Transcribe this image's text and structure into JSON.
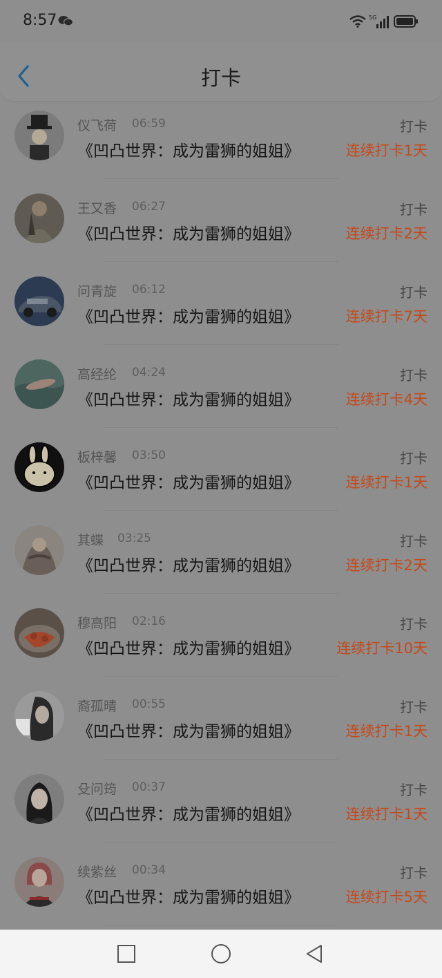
{
  "status": {
    "time": "8:57",
    "network": "5G",
    "icons": [
      "wechat-icon",
      "wifi-icon",
      "signal-icon",
      "battery-icon"
    ]
  },
  "header": {
    "title": "打卡",
    "back_icon": "chevron-left-icon"
  },
  "rows": [
    {
      "name": "仪飞荷",
      "time": "06:59",
      "book": "《凹凸世界：成为雷狮的姐姐》",
      "action": "打卡",
      "streak": "连续打卡1天"
    },
    {
      "name": "王又香",
      "time": "06:27",
      "book": "《凹凸世界：成为雷狮的姐姐》",
      "action": "打卡",
      "streak": "连续打卡2天"
    },
    {
      "name": "问青旋",
      "time": "06:12",
      "book": "《凹凸世界：成为雷狮的姐姐》",
      "action": "打卡",
      "streak": "连续打卡7天"
    },
    {
      "name": "高经纶",
      "time": "04:24",
      "book": "《凹凸世界：成为雷狮的姐姐》",
      "action": "打卡",
      "streak": "连续打卡4天"
    },
    {
      "name": "板梓馨",
      "time": "03:50",
      "book": "《凹凸世界：成为雷狮的姐姐》",
      "action": "打卡",
      "streak": "连续打卡1天"
    },
    {
      "name": "其蝶",
      "time": "03:25",
      "book": "《凹凸世界：成为雷狮的姐姐》",
      "action": "打卡",
      "streak": "连续打卡2天"
    },
    {
      "name": "穆高阳",
      "time": "02:16",
      "book": "《凹凸世界：成为雷狮的姐姐》",
      "action": "打卡",
      "streak": "连续打卡10天"
    },
    {
      "name": "裔孤晴",
      "time": "00:55",
      "book": "《凹凸世界：成为雷狮的姐姐》",
      "action": "打卡",
      "streak": "连续打卡1天"
    },
    {
      "name": "殳问筠",
      "time": "00:37",
      "book": "《凹凸世界：成为雷狮的姐姐》",
      "action": "打卡",
      "streak": "连续打卡1天"
    },
    {
      "name": "续紫丝",
      "time": "00:34",
      "book": "《凹凸世界：成为雷狮的姐姐》",
      "action": "打卡",
      "streak": "连续打卡5天"
    }
  ],
  "colors": {
    "overlay_bg": "#8e8e8e",
    "streak_accent": "#c4491b",
    "back_icon": "#1d5f93",
    "nav_bar": "#f4f4f4"
  },
  "nav": {
    "icons": [
      "recent-apps-icon",
      "home-icon",
      "back-triangle-icon"
    ]
  }
}
